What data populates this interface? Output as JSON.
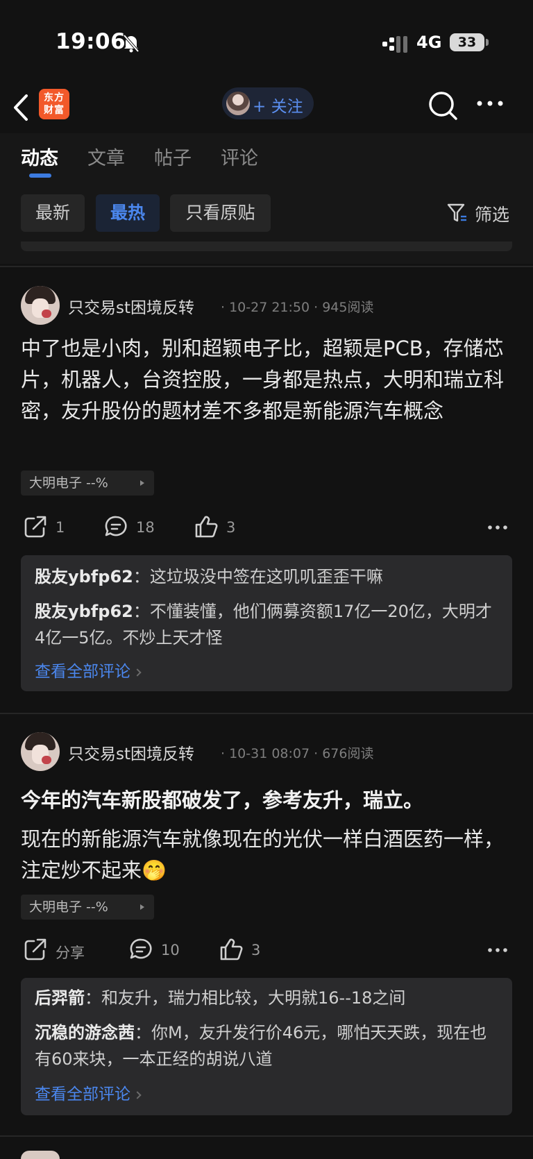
{
  "status_bar": {
    "time": "19:06",
    "network": "4G",
    "battery": "33"
  },
  "nav": {
    "logo_text": "东方财富",
    "follow_label": "+ 关注"
  },
  "tabs": [
    {
      "label": "动态",
      "active": true
    },
    {
      "label": "文章",
      "active": false
    },
    {
      "label": "帖子",
      "active": false
    },
    {
      "label": "评论",
      "active": false
    }
  ],
  "filters": {
    "chips": [
      {
        "label": "最新",
        "active": false
      },
      {
        "label": "最热",
        "active": true
      },
      {
        "label": "只看原贴",
        "active": false
      }
    ],
    "filter_label": "筛选"
  },
  "posts": [
    {
      "author": "只交易st困境反转",
      "meta": "· 10-27 21:50 · 945阅读",
      "title": "",
      "body": "中了也是小肉，别和超颖电子比，超颖是PCB，存储芯片，机器人，台资控股，一身都是热点，大明和瑞立科密，友升股份的题材差不多都是新能源汽车概念",
      "stock_tag": "大明电子 --%",
      "share": "1",
      "comments_count": "18",
      "likes": "3",
      "comments": [
        {
          "user": "股友ybfp62",
          "sep": "：",
          "text": "这垃圾没中签在这叽叽歪歪干嘛"
        },
        {
          "user": "股友ybfp62",
          "sep": "：",
          "text": "不懂装懂，他们俩募资额17亿一20亿，大明才4亿一5亿。不炒上天才怪"
        }
      ],
      "see_all": "查看全部评论"
    },
    {
      "author": "只交易st困境反转",
      "meta": "· 10-31 08:07 · 676阅读",
      "title": "今年的汽车新股都破发了，参考友升，瑞立。",
      "body": "现在的新能源汽车就像现在的光伏一样白酒医药一样，注定炒不起来🤭",
      "stock_tag": "大明电子 --%",
      "share": "分享",
      "comments_count": "10",
      "likes": "3",
      "comments": [
        {
          "user": "后羿箭",
          "sep": "：",
          "text": "和友升，瑞力相比较，大明就16--18之间"
        },
        {
          "user": "沉稳的游念茜",
          "sep": "：",
          "text": "你M，友升发行价46元，哪怕天天跌，现在也有60来块，一本正经的胡说八道"
        }
      ],
      "see_all": "查看全部评论"
    }
  ]
}
